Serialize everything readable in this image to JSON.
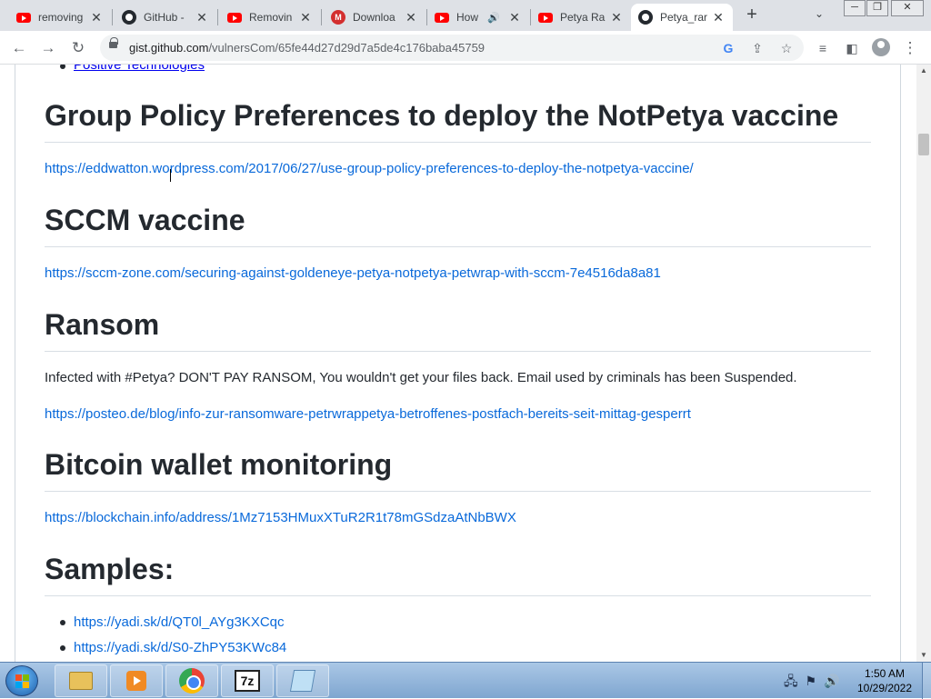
{
  "browser": {
    "tabs": [
      {
        "title": "removing",
        "icon": "youtube-icon",
        "active": false
      },
      {
        "title": "GitHub -",
        "icon": "github-icon",
        "active": false
      },
      {
        "title": "Removin",
        "icon": "youtube-icon",
        "active": false
      },
      {
        "title": "Downloa",
        "icon": "mega-icon",
        "active": false
      },
      {
        "title": "How",
        "icon": "youtube-icon",
        "active": false,
        "audio": true
      },
      {
        "title": "Petya Ra",
        "icon": "youtube-icon",
        "active": false
      },
      {
        "title": "Petya_rar",
        "icon": "github-icon",
        "active": true
      }
    ],
    "new_tab": "+",
    "url_host": "gist.github.com",
    "url_path": "/vulnersCom/65fe44d27d29d7a5de4c176baba45759"
  },
  "page": {
    "top_link": "Positive Technologies",
    "sections": [
      {
        "heading": "Group Policy Preferences to deploy the NotPetya vaccine",
        "link": "https://eddwatton.wordpress.com/2017/06/27/use-group-policy-preferences-to-deploy-the-notpetya-vaccine/"
      },
      {
        "heading": "SCCM vaccine",
        "link": "https://sccm-zone.com/securing-against-goldeneye-petya-notpetya-petwrap-with-sccm-7e4516da8a81"
      },
      {
        "heading": "Ransom",
        "text": "Infected with #Petya? DON'T PAY RANSOM, You wouldn't get your files back. Email used by criminals has been Suspended.",
        "link": "https://posteo.de/blog/info-zur-ransomware-petrwrappetya-betroffenes-postfach-bereits-seit-mittag-gesperrt"
      },
      {
        "heading": "Bitcoin wallet monitoring",
        "link": "https://blockchain.info/address/1Mz7153HMuxXTuR2R1t78mGSdzaAtNbBWX"
      },
      {
        "heading": "Samples:",
        "items": [
          "https://yadi.sk/d/QT0l_AYg3KXCqc",
          "https://yadi.sk/d/S0-ZhPY53KWc84"
        ]
      }
    ]
  },
  "taskbar": {
    "time": "1:50 AM",
    "date": "10/29/2022"
  }
}
